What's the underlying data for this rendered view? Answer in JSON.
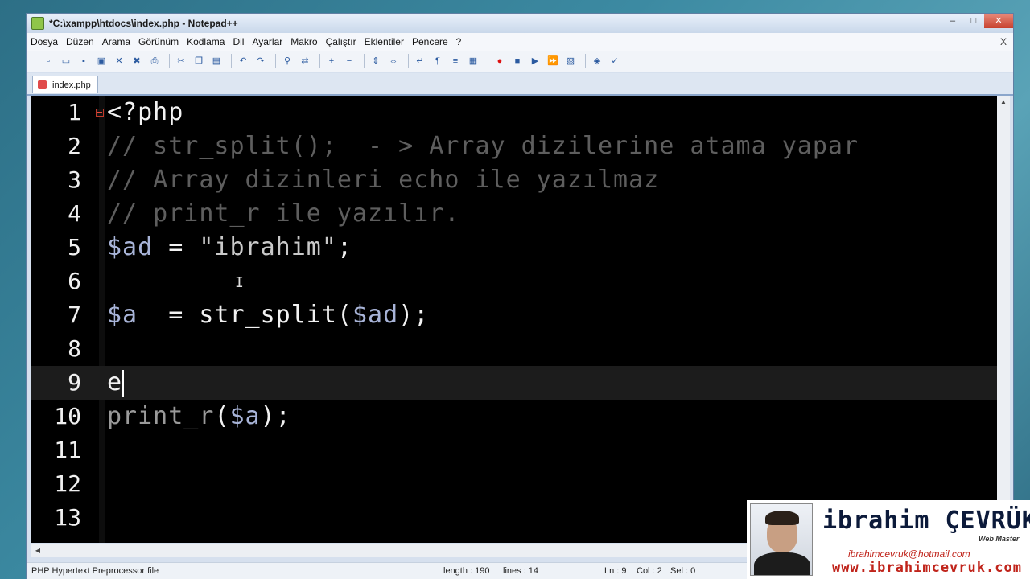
{
  "window": {
    "title": "*C:\\xampp\\htdocs\\index.php - Notepad++"
  },
  "menu": [
    "Dosya",
    "Düzen",
    "Arama",
    "Görünüm",
    "Kodlama",
    "Dil",
    "Ayarlar",
    "Makro",
    "Çalıştır",
    "Eklentiler",
    "Pencere",
    "?"
  ],
  "menu_close": "X",
  "toolbar_icons": [
    "new-file-icon",
    "open-file-icon",
    "save-icon",
    "save-all-icon",
    "close-icon",
    "close-all-icon",
    "print-icon",
    "cut-icon",
    "copy-icon",
    "paste-icon",
    "undo-icon",
    "redo-icon",
    "find-icon",
    "replace-icon",
    "zoom-in-icon",
    "zoom-out-icon",
    "sync-v-icon",
    "sync-h-icon",
    "word-wrap-icon",
    "show-all-chars-icon",
    "indent-guide-icon",
    "user-lang-icon",
    "record-macro-icon",
    "stop-record-icon",
    "play-macro-icon",
    "run-multiple-icon",
    "save-macro-icon",
    "launch-icon",
    "spell-check-icon"
  ],
  "tab": {
    "label": "index.php"
  },
  "editor": {
    "current_line": 9,
    "lines": [
      {
        "num": "1",
        "text": "<?php",
        "kind": "default"
      },
      {
        "num": "2",
        "text": "// str_split();  - > Array dizilerine atama yapar",
        "kind": "comment"
      },
      {
        "num": "3",
        "text": "// Array dizinleri echo ile yazılmaz",
        "kind": "comment"
      },
      {
        "num": "4",
        "text": "// print_r ile yazılır.",
        "kind": "comment"
      },
      {
        "num": "5",
        "text": "$ad = \"ibrahim\";",
        "kind": "mixed"
      },
      {
        "num": "6",
        "text": "",
        "kind": "default"
      },
      {
        "num": "7",
        "text": "$a  = str_split($ad);",
        "kind": "mixed"
      },
      {
        "num": "8",
        "text": "",
        "kind": "default"
      },
      {
        "num": "9",
        "text": "e",
        "kind": "default"
      },
      {
        "num": "10",
        "text": "print_r($a);",
        "kind": "kw"
      },
      {
        "num": "11",
        "text": "",
        "kind": "default"
      },
      {
        "num": "12",
        "text": "",
        "kind": "default"
      },
      {
        "num": "13",
        "text": "",
        "kind": "default"
      }
    ]
  },
  "status": {
    "file_type": "PHP Hypertext Preprocessor file",
    "length": "length : 190",
    "lines": "lines : 14",
    "ln": "Ln : 9",
    "col": "Col : 2",
    "sel": "Sel : 0"
  },
  "brand": {
    "name": "ibrahim ÇEVRÜK",
    "role": "Web Master",
    "email": "ibrahimcevruk@hotmail.com",
    "website": "www.ibrahimcevruk.com"
  },
  "colors": {
    "editor_bg": "#000000",
    "comment": "#5e5e5e",
    "variable": "#a8b4d8",
    "accent": "#c0241b"
  }
}
